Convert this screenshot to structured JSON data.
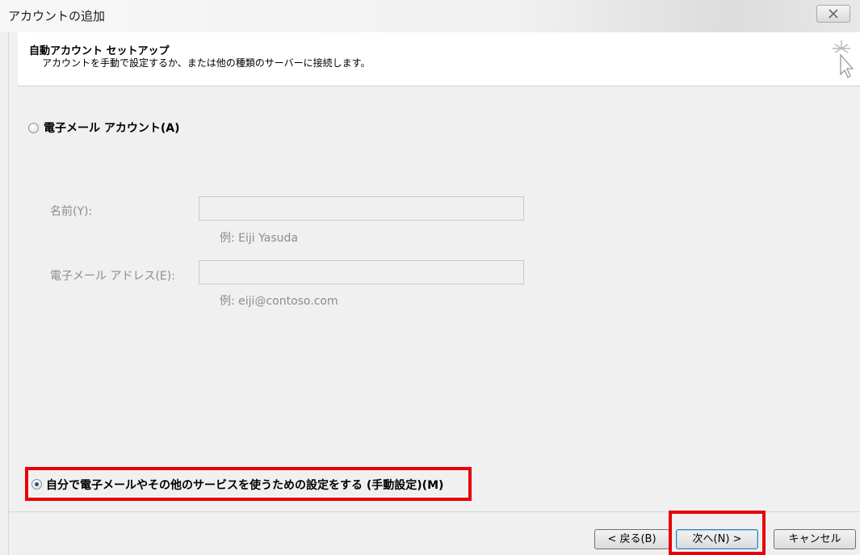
{
  "window": {
    "title": "アカウントの追加"
  },
  "header": {
    "title": "自動アカウント セットアップ",
    "subtitle": "アカウントを手動で設定するか、または他の種類のサーバーに接続します。"
  },
  "options": {
    "email_account": {
      "label": "電子メール アカウント(A)",
      "selected": false
    },
    "manual_setup": {
      "label": "自分で電子メールやその他のサービスを使うための設定をする (手動設定)(M)",
      "selected": true
    }
  },
  "fields": {
    "name": {
      "label": "名前(Y):",
      "value": "",
      "example": "例: Eiji Yasuda"
    },
    "email": {
      "label": "電子メール アドレス(E):",
      "value": "",
      "example": "例: eiji@contoso.com"
    }
  },
  "buttons": {
    "back": "< 戻る(B)",
    "next": "次へ(N) >",
    "cancel": "キャンセル"
  },
  "colors": {
    "highlight": "#e8000b",
    "radio_selected": "#1f4fa0"
  }
}
